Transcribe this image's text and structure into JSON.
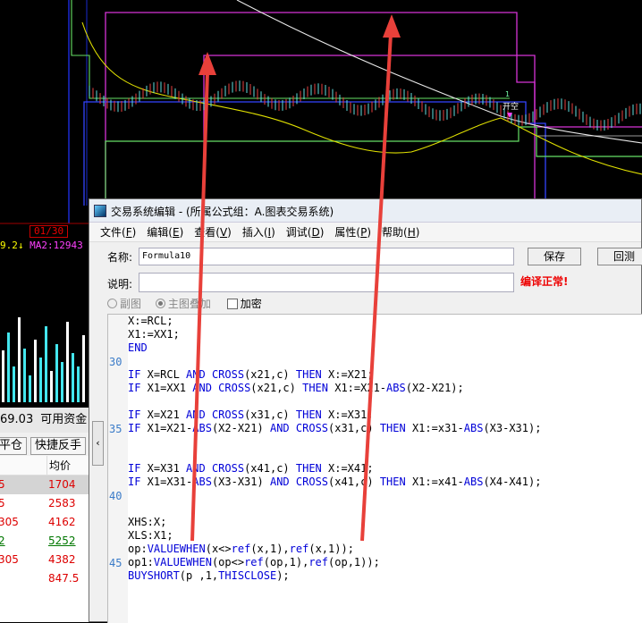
{
  "chart": {
    "marker_label": "开空",
    "marker_num": "1",
    "date_tab": "01/30",
    "ma_values": "9.2↓",
    "ma2_label": "MA2:12943"
  },
  "left_panel": {
    "amount": "69.03",
    "avail_label": "可用资金",
    "btn_close": "平仓",
    "btn_quick": "快捷反手",
    "col_avg": "均价",
    "rows": [
      {
        "a": "5",
        "b": "1704",
        "sel": true,
        "green": false
      },
      {
        "a": "5",
        "b": "2583",
        "sel": false,
        "green": false
      },
      {
        "a": "305",
        "b": "4162",
        "sel": false,
        "green": false
      },
      {
        "a": "2",
        "b": "5252",
        "sel": false,
        "green": true
      },
      {
        "a": "305",
        "b": "4382",
        "sel": false,
        "green": false
      },
      {
        "a": "",
        "b": "847.5",
        "sel": false,
        "green": false
      }
    ]
  },
  "dialog": {
    "title": "交易系统编辑 - (所属公式组：A.图表交易系统)",
    "menu": [
      {
        "label": "文件(",
        "key": "F",
        "end": ")"
      },
      {
        "label": "编辑(",
        "key": "E",
        "end": ")"
      },
      {
        "label": "查看(",
        "key": "V",
        "end": ")"
      },
      {
        "label": "插入(",
        "key": "I",
        "end": ")"
      },
      {
        "label": "调试(",
        "key": "D",
        "end": ")"
      },
      {
        "label": "属性(",
        "key": "P",
        "end": ")"
      },
      {
        "label": "帮助(",
        "key": "H",
        "end": ")"
      }
    ],
    "name_label": "名称:",
    "name_value": "Formula10",
    "desc_label": "说明:",
    "desc_value": "",
    "save_button": "保存",
    "test_button": "回测",
    "status": "编译正常!",
    "opt_sub": "副图",
    "opt_main": "主图叠加",
    "opt_encrypt": "加密",
    "line_numbers": [
      "30",
      "35",
      "40",
      "45"
    ],
    "code_lines": [
      "X:=RCL;",
      "X1:=XX1;",
      "END",
      "",
      "IF X=RCL AND CROSS(x21,c) THEN X:=X21;",
      "IF X1=XX1 AND CROSS(x21,c) THEN X1:=X21-ABS(X2-X21);",
      "",
      "IF X=X21 AND CROSS(x31,c) THEN X:=X31;",
      "IF X1=X21-ABS(X2-X21) AND CROSS(x31,c) THEN X1:=x31-ABS(X3-X31);",
      "",
      "",
      "IF X=X31 AND CROSS(x41,c) THEN X:=X41;",
      "IF X1=X31-ABS(X3-X31) AND CROSS(x41,c) THEN X1:=x41-ABS(X4-X41);",
      "",
      "",
      "XHS:X;",
      "XLS:X1;",
      "op:VALUEWHEN(x<>ref(x,1),ref(x,1));",
      "op1:VALUEWHEN(op<>ref(op,1),ref(op,1));",
      "BUYSHORT(p ,1,THISCLOSE);"
    ]
  }
}
